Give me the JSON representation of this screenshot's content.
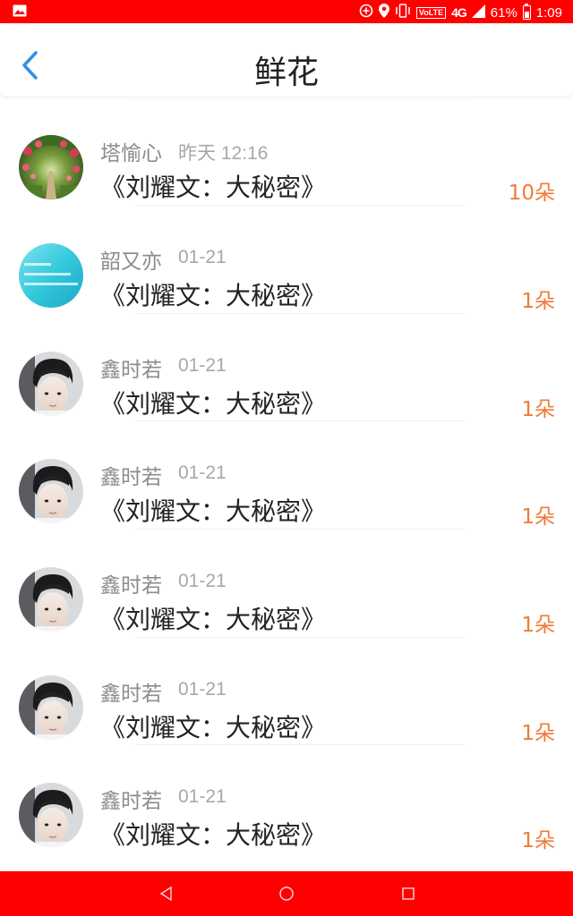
{
  "status_bar": {
    "network": "4G",
    "volte": "VoLTE",
    "battery": "61%",
    "time": "1:09",
    "icons": [
      "image-icon",
      "add-circle-icon",
      "location-icon",
      "vibrate-icon",
      "signal-icon",
      "battery-icon"
    ]
  },
  "header": {
    "title": "鲜花",
    "back_icon": "chevron-left-icon"
  },
  "colors": {
    "status_bar": "#ff0000",
    "accent_blue": "#2f8fe6",
    "count_orange": "#f07a35"
  },
  "records": [
    {
      "name": "塔愉心",
      "time": "昨天 12:16",
      "book": "《刘耀文：大秘密》",
      "count": "10朵",
      "avatar": "garden-avatar"
    },
    {
      "name": "韶又亦",
      "time": "01-21",
      "book": "《刘耀文：大秘密》",
      "count": "1朵",
      "avatar": "teal-avatar"
    },
    {
      "name": "鑫时若",
      "time": "01-21",
      "book": "《刘耀文：大秘密》",
      "count": "1朵",
      "avatar": "portrait-avatar"
    },
    {
      "name": "鑫时若",
      "time": "01-21",
      "book": "《刘耀文：大秘密》",
      "count": "1朵",
      "avatar": "portrait-avatar"
    },
    {
      "name": "鑫时若",
      "time": "01-21",
      "book": "《刘耀文：大秘密》",
      "count": "1朵",
      "avatar": "portrait-avatar"
    },
    {
      "name": "鑫时若",
      "time": "01-21",
      "book": "《刘耀文：大秘密》",
      "count": "1朵",
      "avatar": "portrait-avatar"
    },
    {
      "name": "鑫时若",
      "time": "01-21",
      "book": "《刘耀文：大秘密》",
      "count": "1朵",
      "avatar": "portrait-avatar"
    }
  ],
  "nav_bar": {
    "buttons": [
      "back-triangle-icon",
      "home-circle-icon",
      "recents-square-icon"
    ]
  }
}
